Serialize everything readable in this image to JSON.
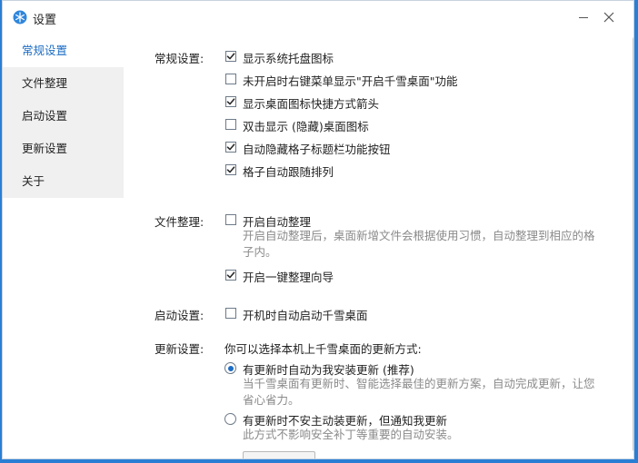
{
  "window": {
    "title": "设置"
  },
  "sidebar": {
    "items": [
      {
        "label": "常规设置",
        "active": true
      },
      {
        "label": "文件整理"
      },
      {
        "label": "启动设置"
      },
      {
        "label": "更新设置"
      },
      {
        "label": "关于"
      }
    ]
  },
  "general": {
    "label": "常规设置:",
    "options": [
      {
        "label": "显示系统托盘图标",
        "checked": true
      },
      {
        "label": "未开启时右键菜单显示\"开启千雪桌面\"功能",
        "checked": false
      },
      {
        "label": "显示桌面图标快捷方式箭头",
        "checked": true
      },
      {
        "label": "双击显示 (隐藏)桌面图标",
        "checked": false
      },
      {
        "label": "自动隐藏格子标题栏功能按钮",
        "checked": true
      },
      {
        "label": "格子自动跟随排列",
        "checked": true
      }
    ]
  },
  "file_org": {
    "label": "文件整理:",
    "auto_label": "开启自动整理",
    "auto_checked": false,
    "auto_desc_line1": "开启自动整理后，桌面新增文件会根据使用习惯，自动整理到相应的格",
    "auto_desc_line2": "子内。",
    "wizard_label": "开启一键整理向导",
    "wizard_checked": true
  },
  "startup": {
    "label": "启动设置:",
    "option_label": "开机时自动启动千雪桌面",
    "checked": false
  },
  "update": {
    "label": "更新设置:",
    "intro": "你可以选择本机上千雪桌面的更新方式:",
    "auto_label": "有更新时自动为我安装更新 (推荐)",
    "auto_selected": true,
    "auto_desc_line1": "当千雪桌面有更新时、智能选择最佳的更新方案，自动完成更新，让您",
    "auto_desc_line2": "省心省力。",
    "notify_label": "有更新时不安主动装更新，但通知我更新",
    "notify_selected": false,
    "notify_desc": "此方式不影响安全补丁等重要的自动安装。"
  },
  "colors": {
    "accent": "#1c6dc4",
    "desktop": "#2a7fd4",
    "sidebar_bg": "#f0f0f0"
  }
}
